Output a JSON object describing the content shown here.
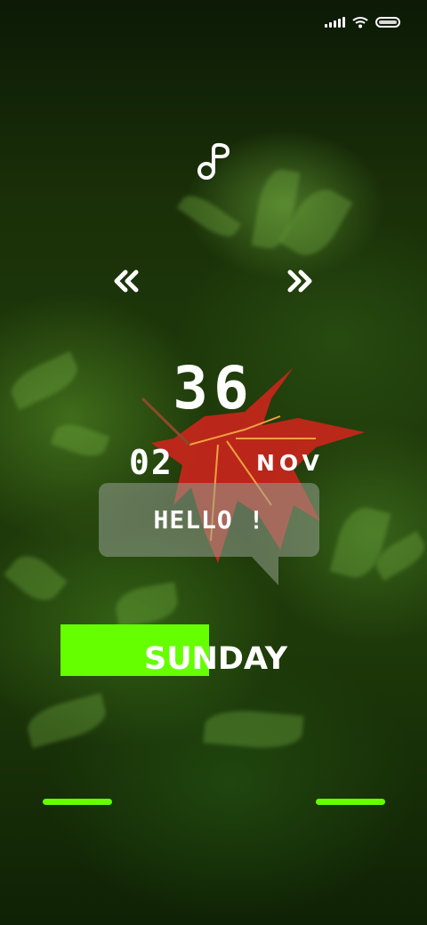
{
  "colors": {
    "accent": "#66ff00",
    "text": "#ffffff",
    "bubble": "#969f91"
  },
  "status_bar": {
    "icons": [
      "signal-icon",
      "wifi-icon",
      "battery-icon"
    ]
  },
  "widget": {
    "icons": [
      "music-note-icon",
      "previous-double-chevron-icon",
      "next-double-chevron-icon"
    ],
    "big_number": "36",
    "day": "02",
    "month": "NOV",
    "greeting": "HELLO !",
    "weekday": "SUNDAY"
  }
}
